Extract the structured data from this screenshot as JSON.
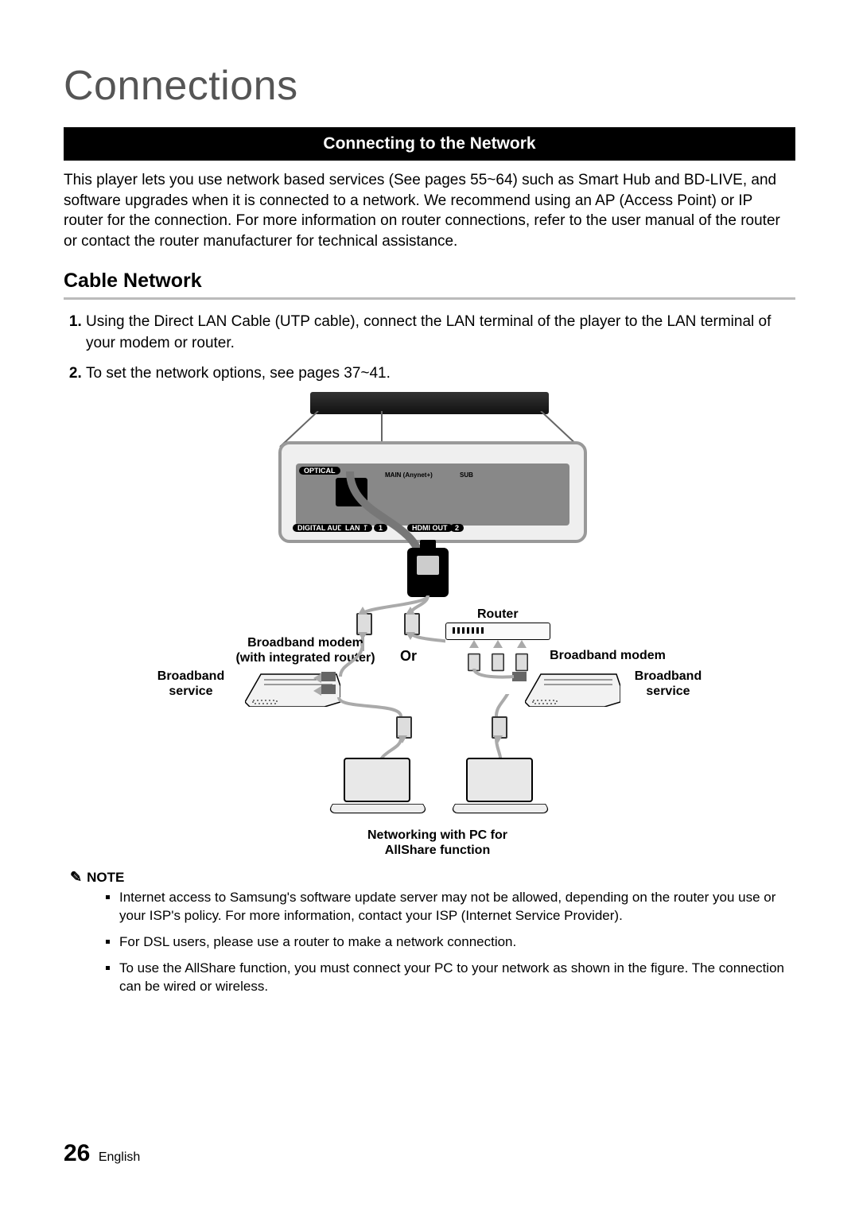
{
  "chapter": "Connections",
  "section_bar": "Connecting to the Network",
  "intro": "This player lets you use network based services (See pages 55~64) such as Smart Hub and BD-LIVE, and software upgrades when it is connected to a network. We recommend using an AP (Access Point) or IP router for the connection. For more information on router connections, refer to the user manual of the router or contact the router manufacturer for technical assistance.",
  "sub_heading": "Cable Network",
  "steps": [
    "Using the Direct LAN Cable (UTP cable), connect the LAN terminal of the player to the LAN terminal of your modem or router.",
    "To set the network options, see pages 37~41."
  ],
  "diagram": {
    "panel_labels": {
      "optical": "OPTICAL",
      "digital": "DIGITAL AUDIO OUT",
      "lan": "LAN",
      "hdmi": "HDMI OUT",
      "main": "MAIN (Anynet+)",
      "sub": "SUB",
      "n1": "1",
      "n2": "2"
    },
    "router": "Router",
    "or": "Or",
    "broadband_modem_int": "Broadband modem\n(with integrated router)",
    "broadband_modem": "Broadband modem",
    "broadband_service_l": "Broadband\nservice",
    "broadband_service_r": "Broadband\nservice",
    "pc_caption": "Networking with PC for\nAllShare function"
  },
  "note_label": "NOTE",
  "notes": [
    "Internet access to Samsung's software update server may not be allowed, depending on the router you use or your ISP's policy. For more information, contact your ISP (Internet Service Provider).",
    "For DSL users, please use a router to make a network connection.",
    "To use the AllShare function, you must connect your PC to your network as shown in the figure. The connection can be wired or wireless."
  ],
  "footer": {
    "page": "26",
    "lang": "English"
  }
}
